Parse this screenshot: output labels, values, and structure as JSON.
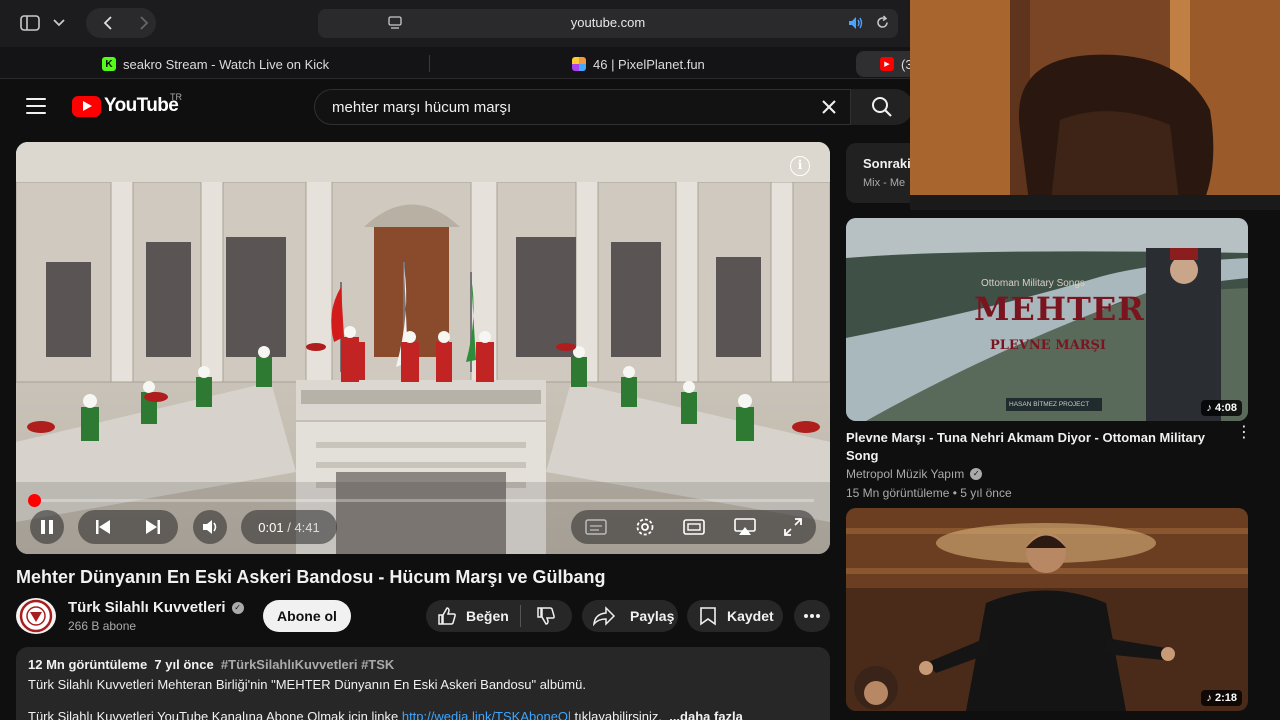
{
  "browser": {
    "url": "youtube.com",
    "tabs": [
      {
        "title": "seakro Stream - Watch Live on Kick",
        "favicon": "kick-icon"
      },
      {
        "title": "46 | PixelPlanet.fun",
        "favicon": "pixelplanet-icon"
      },
      {
        "title": "(3",
        "favicon": "youtube-icon"
      }
    ]
  },
  "header": {
    "logo_text": "YouTube",
    "country_code": "TR",
    "search_value": "mehter marşı hücum marşı"
  },
  "player": {
    "time_current": "0:01",
    "time_separator": "/",
    "time_total": "4:41",
    "progress": 0.003
  },
  "video": {
    "title": "Mehter Dünyanın En Eski Askeri Bandosu - Hücum Marşı ve Gülbang",
    "channel_name": "Türk Silahlı Kuvvetleri",
    "subscribers": "266 B abone",
    "subscribe_label": "Abone ol",
    "like_label": "Beğen",
    "share_label": "Paylaş",
    "save_label": "Kaydet"
  },
  "description": {
    "views": "12 Mn görüntüleme",
    "age": "7 yıl önce",
    "tags": "#TürkSilahlıKuvvetleri #TSK",
    "line1": "Türk Silahlı Kuvvetleri  Mehteran Birliği'nin \"MEHTER Dünyanın En Eski Askeri Bandosu\" albümü.",
    "line2_prefix": "Türk Silahlı Kuvvetleri YouTube Kanalına Abone Olmak için linke ",
    "line2_link": "http://wedia.link/TSKAboneOl",
    "line2_suffix": " tıklayabilirsiniz.",
    "more_label": "...daha fazla"
  },
  "sidebar": {
    "next_title": "Sonraki",
    "next_sub": "Mix - Me",
    "recommendations": [
      {
        "title": "Plevne Marşı - Tuna Nehri Akmam Diyor - Ottoman Military Song",
        "channel": "Metropol Müzik Yapım",
        "views": "15 Mn görüntüleme",
        "age": "5 yıl önce",
        "duration": "4:08",
        "thumb_text_small": "Ottoman Military Songs",
        "thumb_text_big": "MEHTER",
        "thumb_text_sub": "PLEVNE MARŞI",
        "thumb_text_credit": "HASAN BİTMEZ PROJECT"
      },
      {
        "duration": "2:18"
      }
    ]
  },
  "colors": {
    "brand_red": "#ff0000",
    "link_blue": "#3ea6ff",
    "background": "#0f0f0f"
  }
}
